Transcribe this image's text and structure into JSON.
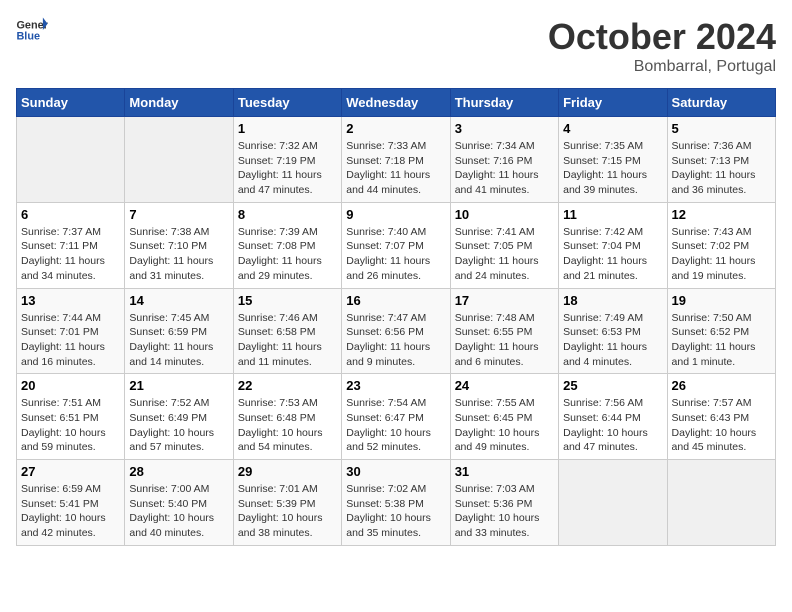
{
  "header": {
    "logo_general": "General",
    "logo_blue": "Blue",
    "title": "October 2024",
    "location": "Bombarral, Portugal"
  },
  "days_of_week": [
    "Sunday",
    "Monday",
    "Tuesday",
    "Wednesday",
    "Thursday",
    "Friday",
    "Saturday"
  ],
  "weeks": [
    [
      {
        "day": "",
        "info": ""
      },
      {
        "day": "",
        "info": ""
      },
      {
        "day": "1",
        "info": "Sunrise: 7:32 AM\nSunset: 7:19 PM\nDaylight: 11 hours and 47 minutes."
      },
      {
        "day": "2",
        "info": "Sunrise: 7:33 AM\nSunset: 7:18 PM\nDaylight: 11 hours and 44 minutes."
      },
      {
        "day": "3",
        "info": "Sunrise: 7:34 AM\nSunset: 7:16 PM\nDaylight: 11 hours and 41 minutes."
      },
      {
        "day": "4",
        "info": "Sunrise: 7:35 AM\nSunset: 7:15 PM\nDaylight: 11 hours and 39 minutes."
      },
      {
        "day": "5",
        "info": "Sunrise: 7:36 AM\nSunset: 7:13 PM\nDaylight: 11 hours and 36 minutes."
      }
    ],
    [
      {
        "day": "6",
        "info": "Sunrise: 7:37 AM\nSunset: 7:11 PM\nDaylight: 11 hours and 34 minutes."
      },
      {
        "day": "7",
        "info": "Sunrise: 7:38 AM\nSunset: 7:10 PM\nDaylight: 11 hours and 31 minutes."
      },
      {
        "day": "8",
        "info": "Sunrise: 7:39 AM\nSunset: 7:08 PM\nDaylight: 11 hours and 29 minutes."
      },
      {
        "day": "9",
        "info": "Sunrise: 7:40 AM\nSunset: 7:07 PM\nDaylight: 11 hours and 26 minutes."
      },
      {
        "day": "10",
        "info": "Sunrise: 7:41 AM\nSunset: 7:05 PM\nDaylight: 11 hours and 24 minutes."
      },
      {
        "day": "11",
        "info": "Sunrise: 7:42 AM\nSunset: 7:04 PM\nDaylight: 11 hours and 21 minutes."
      },
      {
        "day": "12",
        "info": "Sunrise: 7:43 AM\nSunset: 7:02 PM\nDaylight: 11 hours and 19 minutes."
      }
    ],
    [
      {
        "day": "13",
        "info": "Sunrise: 7:44 AM\nSunset: 7:01 PM\nDaylight: 11 hours and 16 minutes."
      },
      {
        "day": "14",
        "info": "Sunrise: 7:45 AM\nSunset: 6:59 PM\nDaylight: 11 hours and 14 minutes."
      },
      {
        "day": "15",
        "info": "Sunrise: 7:46 AM\nSunset: 6:58 PM\nDaylight: 11 hours and 11 minutes."
      },
      {
        "day": "16",
        "info": "Sunrise: 7:47 AM\nSunset: 6:56 PM\nDaylight: 11 hours and 9 minutes."
      },
      {
        "day": "17",
        "info": "Sunrise: 7:48 AM\nSunset: 6:55 PM\nDaylight: 11 hours and 6 minutes."
      },
      {
        "day": "18",
        "info": "Sunrise: 7:49 AM\nSunset: 6:53 PM\nDaylight: 11 hours and 4 minutes."
      },
      {
        "day": "19",
        "info": "Sunrise: 7:50 AM\nSunset: 6:52 PM\nDaylight: 11 hours and 1 minute."
      }
    ],
    [
      {
        "day": "20",
        "info": "Sunrise: 7:51 AM\nSunset: 6:51 PM\nDaylight: 10 hours and 59 minutes."
      },
      {
        "day": "21",
        "info": "Sunrise: 7:52 AM\nSunset: 6:49 PM\nDaylight: 10 hours and 57 minutes."
      },
      {
        "day": "22",
        "info": "Sunrise: 7:53 AM\nSunset: 6:48 PM\nDaylight: 10 hours and 54 minutes."
      },
      {
        "day": "23",
        "info": "Sunrise: 7:54 AM\nSunset: 6:47 PM\nDaylight: 10 hours and 52 minutes."
      },
      {
        "day": "24",
        "info": "Sunrise: 7:55 AM\nSunset: 6:45 PM\nDaylight: 10 hours and 49 minutes."
      },
      {
        "day": "25",
        "info": "Sunrise: 7:56 AM\nSunset: 6:44 PM\nDaylight: 10 hours and 47 minutes."
      },
      {
        "day": "26",
        "info": "Sunrise: 7:57 AM\nSunset: 6:43 PM\nDaylight: 10 hours and 45 minutes."
      }
    ],
    [
      {
        "day": "27",
        "info": "Sunrise: 6:59 AM\nSunset: 5:41 PM\nDaylight: 10 hours and 42 minutes."
      },
      {
        "day": "28",
        "info": "Sunrise: 7:00 AM\nSunset: 5:40 PM\nDaylight: 10 hours and 40 minutes."
      },
      {
        "day": "29",
        "info": "Sunrise: 7:01 AM\nSunset: 5:39 PM\nDaylight: 10 hours and 38 minutes."
      },
      {
        "day": "30",
        "info": "Sunrise: 7:02 AM\nSunset: 5:38 PM\nDaylight: 10 hours and 35 minutes."
      },
      {
        "day": "31",
        "info": "Sunrise: 7:03 AM\nSunset: 5:36 PM\nDaylight: 10 hours and 33 minutes."
      },
      {
        "day": "",
        "info": ""
      },
      {
        "day": "",
        "info": ""
      }
    ]
  ]
}
